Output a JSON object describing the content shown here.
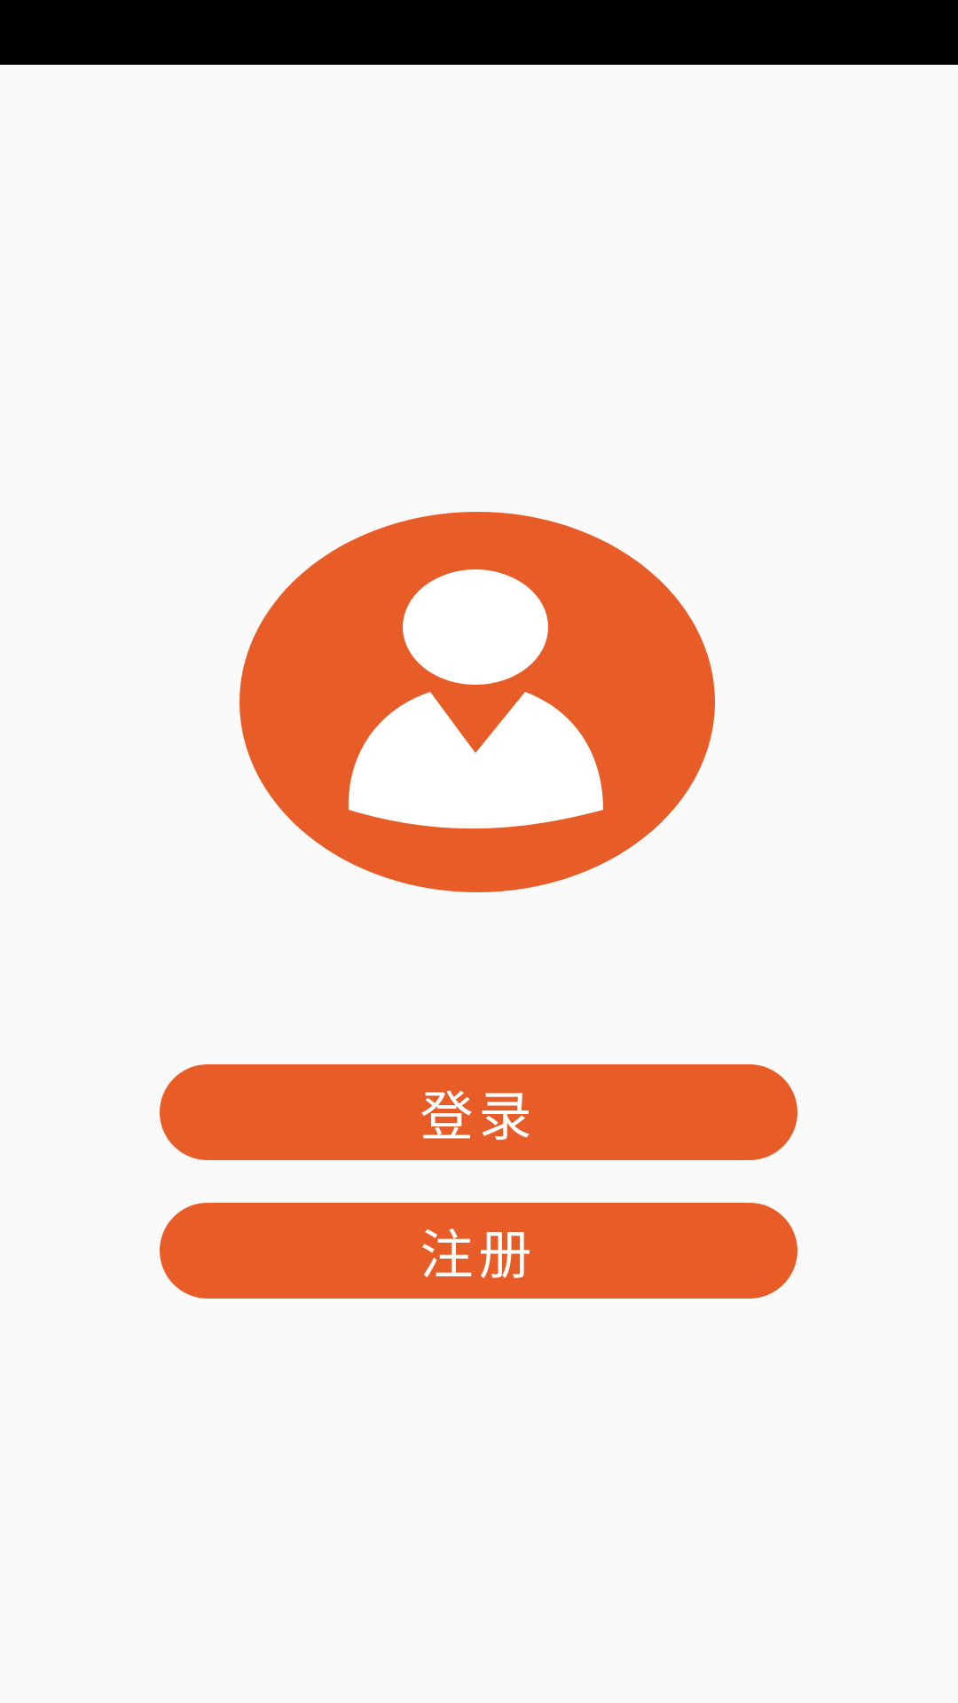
{
  "theme": {
    "accent": "#e85d27",
    "background": "#fafafa",
    "status_bar": "#000000"
  },
  "avatar": {
    "icon": "user-avatar-icon"
  },
  "buttons": {
    "login_label": "登录",
    "register_label": "注册"
  }
}
